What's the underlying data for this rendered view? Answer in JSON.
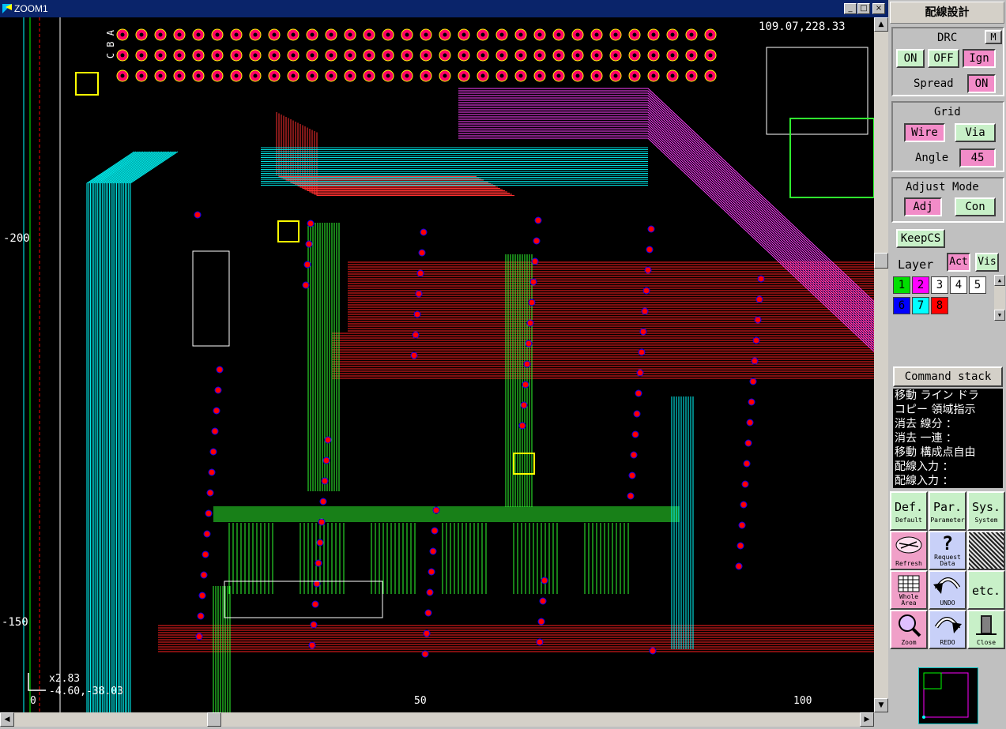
{
  "window": {
    "title": "ZOOM1",
    "minimize": "_",
    "maximize": "□",
    "close": "×"
  },
  "canvas": {
    "coord_top": "109.07,228.33",
    "ruler_y": [
      "-200",
      "-150"
    ],
    "ruler_x": [
      "0",
      "50",
      "100"
    ],
    "cursor_readout_line1": "x2.83",
    "cursor_readout_line2": "-4.60,-38.03",
    "connector_rows": [
      "C",
      "B",
      "A"
    ]
  },
  "panel": {
    "title": "配線設計",
    "drc": {
      "label": "DRC",
      "m_label": "M",
      "on": "ON",
      "off": "OFF",
      "ign": "Ign",
      "spread_label": "Spread",
      "spread_value": "ON"
    },
    "grid": {
      "label": "Grid",
      "wire": "Wire",
      "via": "Via",
      "angle_label": "Angle",
      "angle_value": "45"
    },
    "adjust": {
      "label": "Adjust Mode",
      "adj": "Adj",
      "con": "Con"
    },
    "keepcs": "KeepCS",
    "layer": {
      "label": "Layer",
      "act": "Act",
      "vis": "Vis",
      "boxes": [
        {
          "num": "1",
          "color": "#00e000"
        },
        {
          "num": "2",
          "color": "#ff00ff"
        },
        {
          "num": "3",
          "color": "#ffffff"
        },
        {
          "num": "4",
          "color": "#ffffff"
        },
        {
          "num": "5",
          "color": "#ffffff"
        },
        {
          "num": "6",
          "color": "#0000ff"
        },
        {
          "num": "7",
          "color": "#00ffff"
        },
        {
          "num": "8",
          "color": "#ff0000"
        }
      ]
    },
    "command_stack": {
      "title": "Command stack",
      "items": [
        "移動 ライン ドラ",
        "コピー 領域指示",
        "消去 線分 ：",
        "消去 一連 ：",
        "移動 構成点自由",
        "配線入力 ：",
        "配線入力 ："
      ]
    },
    "buttons": {
      "def": "Def.",
      "def_sub": "Default",
      "par": "Par.",
      "par_sub": "Parameter",
      "sys": "Sys.",
      "sys_sub": "System",
      "refresh": "Refresh",
      "request": "Request Data",
      "whole": "Whole Area",
      "undo": "UNDO",
      "etc": "etc.",
      "zoom": "Zoom",
      "redo": "REDO",
      "close": "Close"
    }
  }
}
